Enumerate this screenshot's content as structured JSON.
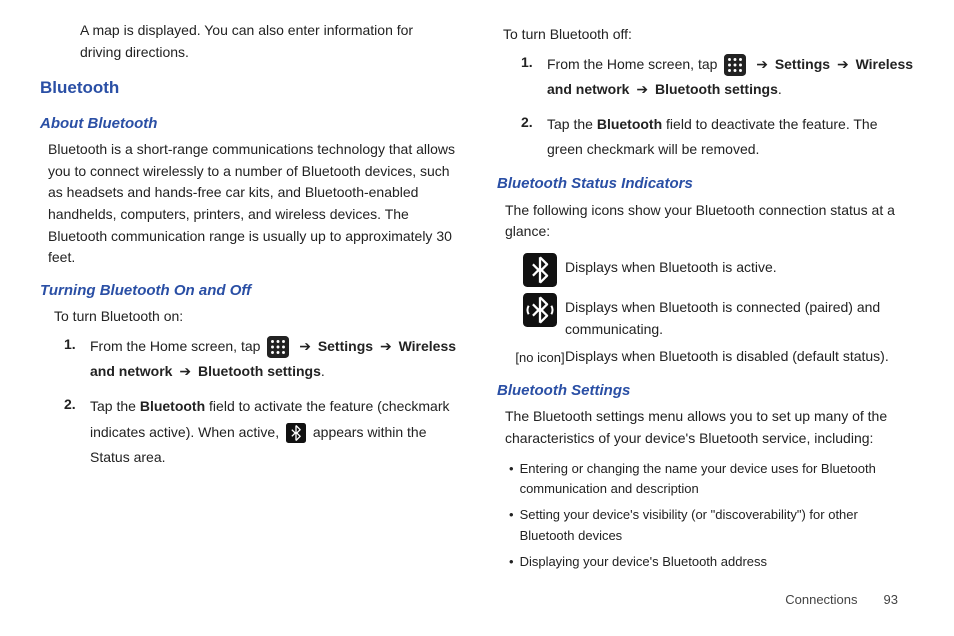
{
  "left": {
    "continuation": "A map is displayed. You can also enter information for driving directions.",
    "section": "Bluetooth",
    "about_h": "About Bluetooth",
    "about_p": "Bluetooth is a short-range communications technology that allows you to connect wirelessly to a number of Bluetooth devices, such as headsets and hands-free car kits, and Bluetooth-enabled handhelds, computers, printers, and wireless devices. The Bluetooth communication range is usually up to approximately 30 feet.",
    "turn_h": "Turning Bluetooth On and Off",
    "turn_on_lead": "To turn Bluetooth on:",
    "arrow": "➔",
    "s1": {
      "n": "1.",
      "a": "From the Home screen, tap",
      "b1": "Settings",
      "b2": "Wireless and network",
      "b3": "Bluetooth settings",
      "dot": "."
    },
    "s2": {
      "n": "2.",
      "a": "Tap the ",
      "b": "Bluetooth",
      "c": " field to activate the feature (checkmark indicates active). When active, ",
      "d": " appears within the Status area."
    }
  },
  "right": {
    "off_lead": "To turn Bluetooth off:",
    "arrow": "➔",
    "s1": {
      "n": "1.",
      "a": "From the Home screen, tap",
      "b1": "Settings",
      "b2": "Wireless and network",
      "b3": "Bluetooth settings",
      "dot": "."
    },
    "s2": {
      "n": "2.",
      "a": "Tap the ",
      "b": "Bluetooth",
      "c": " field to deactivate the feature. The green checkmark will be removed."
    },
    "status_h": "Bluetooth Status Indicators",
    "status_p": "The following icons show your Bluetooth connection status at a glance:",
    "row1": "Displays when Bluetooth is active.",
    "row2": "Displays when Bluetooth is connected (paired) and communicating.",
    "noicon_label": "[no icon]",
    "row3": "Displays when Bluetooth is disabled (default status).",
    "settings_h": "Bluetooth Settings",
    "settings_p": "The Bluetooth settings menu allows you to set up many of the characteristics of your device's Bluetooth service, including:",
    "b1": "Entering or changing the name your device uses for Bluetooth communication and description",
    "b2": "Setting your device's visibility (or \"discoverability\") for other Bluetooth devices",
    "b3": "Displaying your device's Bluetooth address"
  },
  "footer": {
    "section": "Connections",
    "page": "93"
  }
}
